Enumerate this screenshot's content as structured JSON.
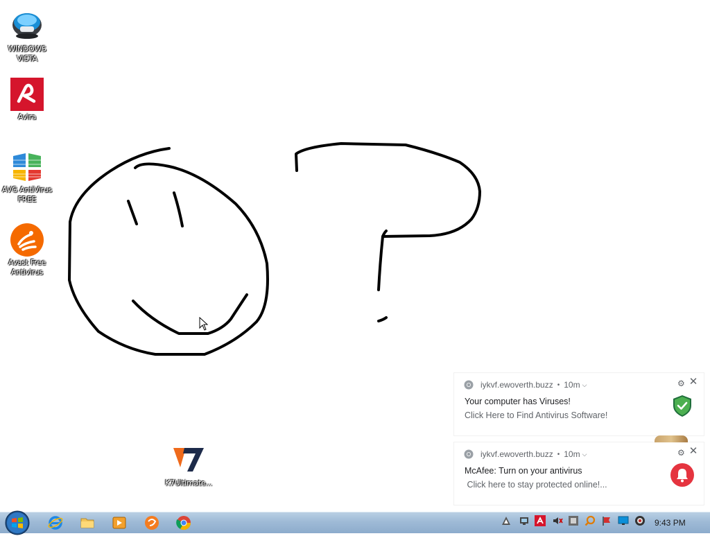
{
  "desktop": {
    "icons": [
      {
        "label": "WINDOWS VISTA",
        "icon": "windows-vista-icon"
      },
      {
        "label": "Avira",
        "icon": "avira-icon"
      },
      {
        "label": "AVG AntiVirus FREE",
        "icon": "avg-icon"
      },
      {
        "label": "Avast Free Antivirus",
        "icon": "avast-icon"
      },
      {
        "label": "K7Ultimate...",
        "icon": "k7-icon"
      }
    ]
  },
  "notifications": [
    {
      "source": "iykvf.ewoverth.buzz",
      "time": "10m",
      "title": "Your computer has Viruses!",
      "message": "Click Here to Find Antivirus Software!",
      "side_icon": "green-shield-icon"
    },
    {
      "source": "iykvf.ewoverth.buzz",
      "time": "10m",
      "title": "McAfee: Turn on your antivirus",
      "message": " Click here to stay protected online!...",
      "side_icon": "red-bell-icon"
    }
  ],
  "taskbar": {
    "pinned": [
      "internet-explorer-icon",
      "file-explorer-icon",
      "media-player-icon",
      "uc-browser-icon",
      "chrome-icon"
    ],
    "tray": [
      "avast-tray-icon",
      "network-tray-icon",
      "avira-tray-icon",
      "volume-tray-icon",
      "antivirus-tray-icon",
      "search-tray-icon",
      "flag-tray-icon",
      "display-tray-icon",
      "webcam-tray-icon"
    ],
    "clock": "9:43 PM"
  },
  "colors": {
    "taskbar": "#9ebad6",
    "avira_red": "#d5152c",
    "avast_orange": "#f56a00",
    "bell_red": "#e5343f",
    "shield_green": "#4caf50"
  }
}
